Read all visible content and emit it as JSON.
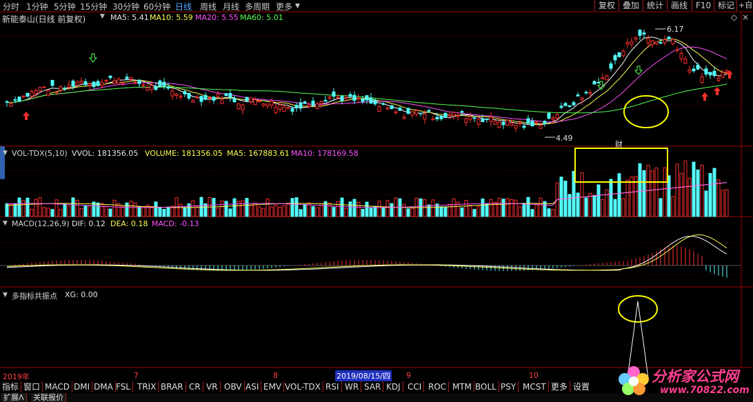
{
  "toolbar": {
    "periods": [
      "分时",
      "1分钟",
      "5分钟",
      "15分钟",
      "30分钟",
      "60分钟",
      "日线",
      "周线",
      "月线",
      "多周期",
      "更多"
    ],
    "active_period": "日线",
    "right_tabs": [
      "复权",
      "叠加",
      "统计",
      "画线",
      "F10",
      "标记",
      "+自"
    ]
  },
  "main_panel": {
    "title": "新能泰山(日线 前复权)",
    "ma5": "MA5: 5.41",
    "ma10": "MA10: 5.59",
    "ma20": "MA20: 5.55",
    "ma60": "MA60: 5.01",
    "high_label": "6.17",
    "low_label": "4.49"
  },
  "vol_panel": {
    "name": "VOL-TDX(5,10)",
    "vvol": "VVOL: 181356.05",
    "volume": "VOLUME: 181356.05",
    "ma5": "MA5: 167883.61",
    "ma10": "MA10: 178169.58",
    "annotation": "财"
  },
  "macd_panel": {
    "name": "MACD(12,26,9)",
    "dif": "DIF: 0.12",
    "dea": "DEA: 0.18",
    "macd": "MACD: -0.13"
  },
  "xg_panel": {
    "name": "多指标共振点",
    "xg": "XG: 0.00"
  },
  "timeline": {
    "year": "2019年",
    "m7": "7",
    "m8": "8",
    "cursor_date": "2019/08/15/四",
    "m9": "9",
    "m10": "10"
  },
  "indicator_tabs": [
    "指标",
    "窗口",
    "MACD",
    "DMI",
    "DMA",
    "FSL",
    "TRIX",
    "BRAR",
    "CR",
    "VR",
    "OBV",
    "ASI",
    "EMV",
    "VOL-TDX",
    "RSI",
    "WR",
    "SAR",
    "KDJ",
    "CCI",
    "ROC",
    "MTM",
    "BOLL",
    "PSY",
    "MCST",
    "更多",
    "设置"
  ],
  "footer_tabs": [
    "扩展Λ",
    "关联报价"
  ],
  "watermark": {
    "title": "分析家公式网",
    "url": "www.70822.com"
  },
  "colors": {
    "up": "#ff3030",
    "down": "#54fcfc",
    "ma5": "#ffffff",
    "ma10": "#ffff54",
    "ma20": "#ff54ff",
    "ma60": "#54ff54",
    "separator": "#a00000"
  },
  "chart_data": {
    "type": "candlestick",
    "price_range": [
      4.3,
      6.3
    ],
    "max_price": 6.17,
    "min_price": 4.49,
    "close_trend": [
      4.95,
      5.05,
      5.2,
      5.15,
      5.3,
      5.25,
      5.35,
      5.3,
      5.2,
      5.15,
      5.05,
      5.0,
      5.05,
      4.95,
      5.0,
      4.9,
      4.85,
      4.95,
      5.05,
      5.0,
      4.95,
      4.85,
      4.75,
      4.8,
      4.7,
      4.75,
      4.7,
      4.65,
      4.6,
      4.55,
      4.65,
      4.85,
      5.05,
      5.3,
      5.7,
      6.1,
      5.95,
      6.0,
      5.5,
      5.35,
      5.45
    ],
    "ma5": 5.41,
    "ma10": 5.59,
    "ma20": 5.55,
    "ma60": 5.01,
    "volume": 181356.05,
    "volume_ma5": 167883.61,
    "volume_ma10": 178169.58,
    "dif": 0.12,
    "dea": 0.18,
    "macd": -0.13
  }
}
